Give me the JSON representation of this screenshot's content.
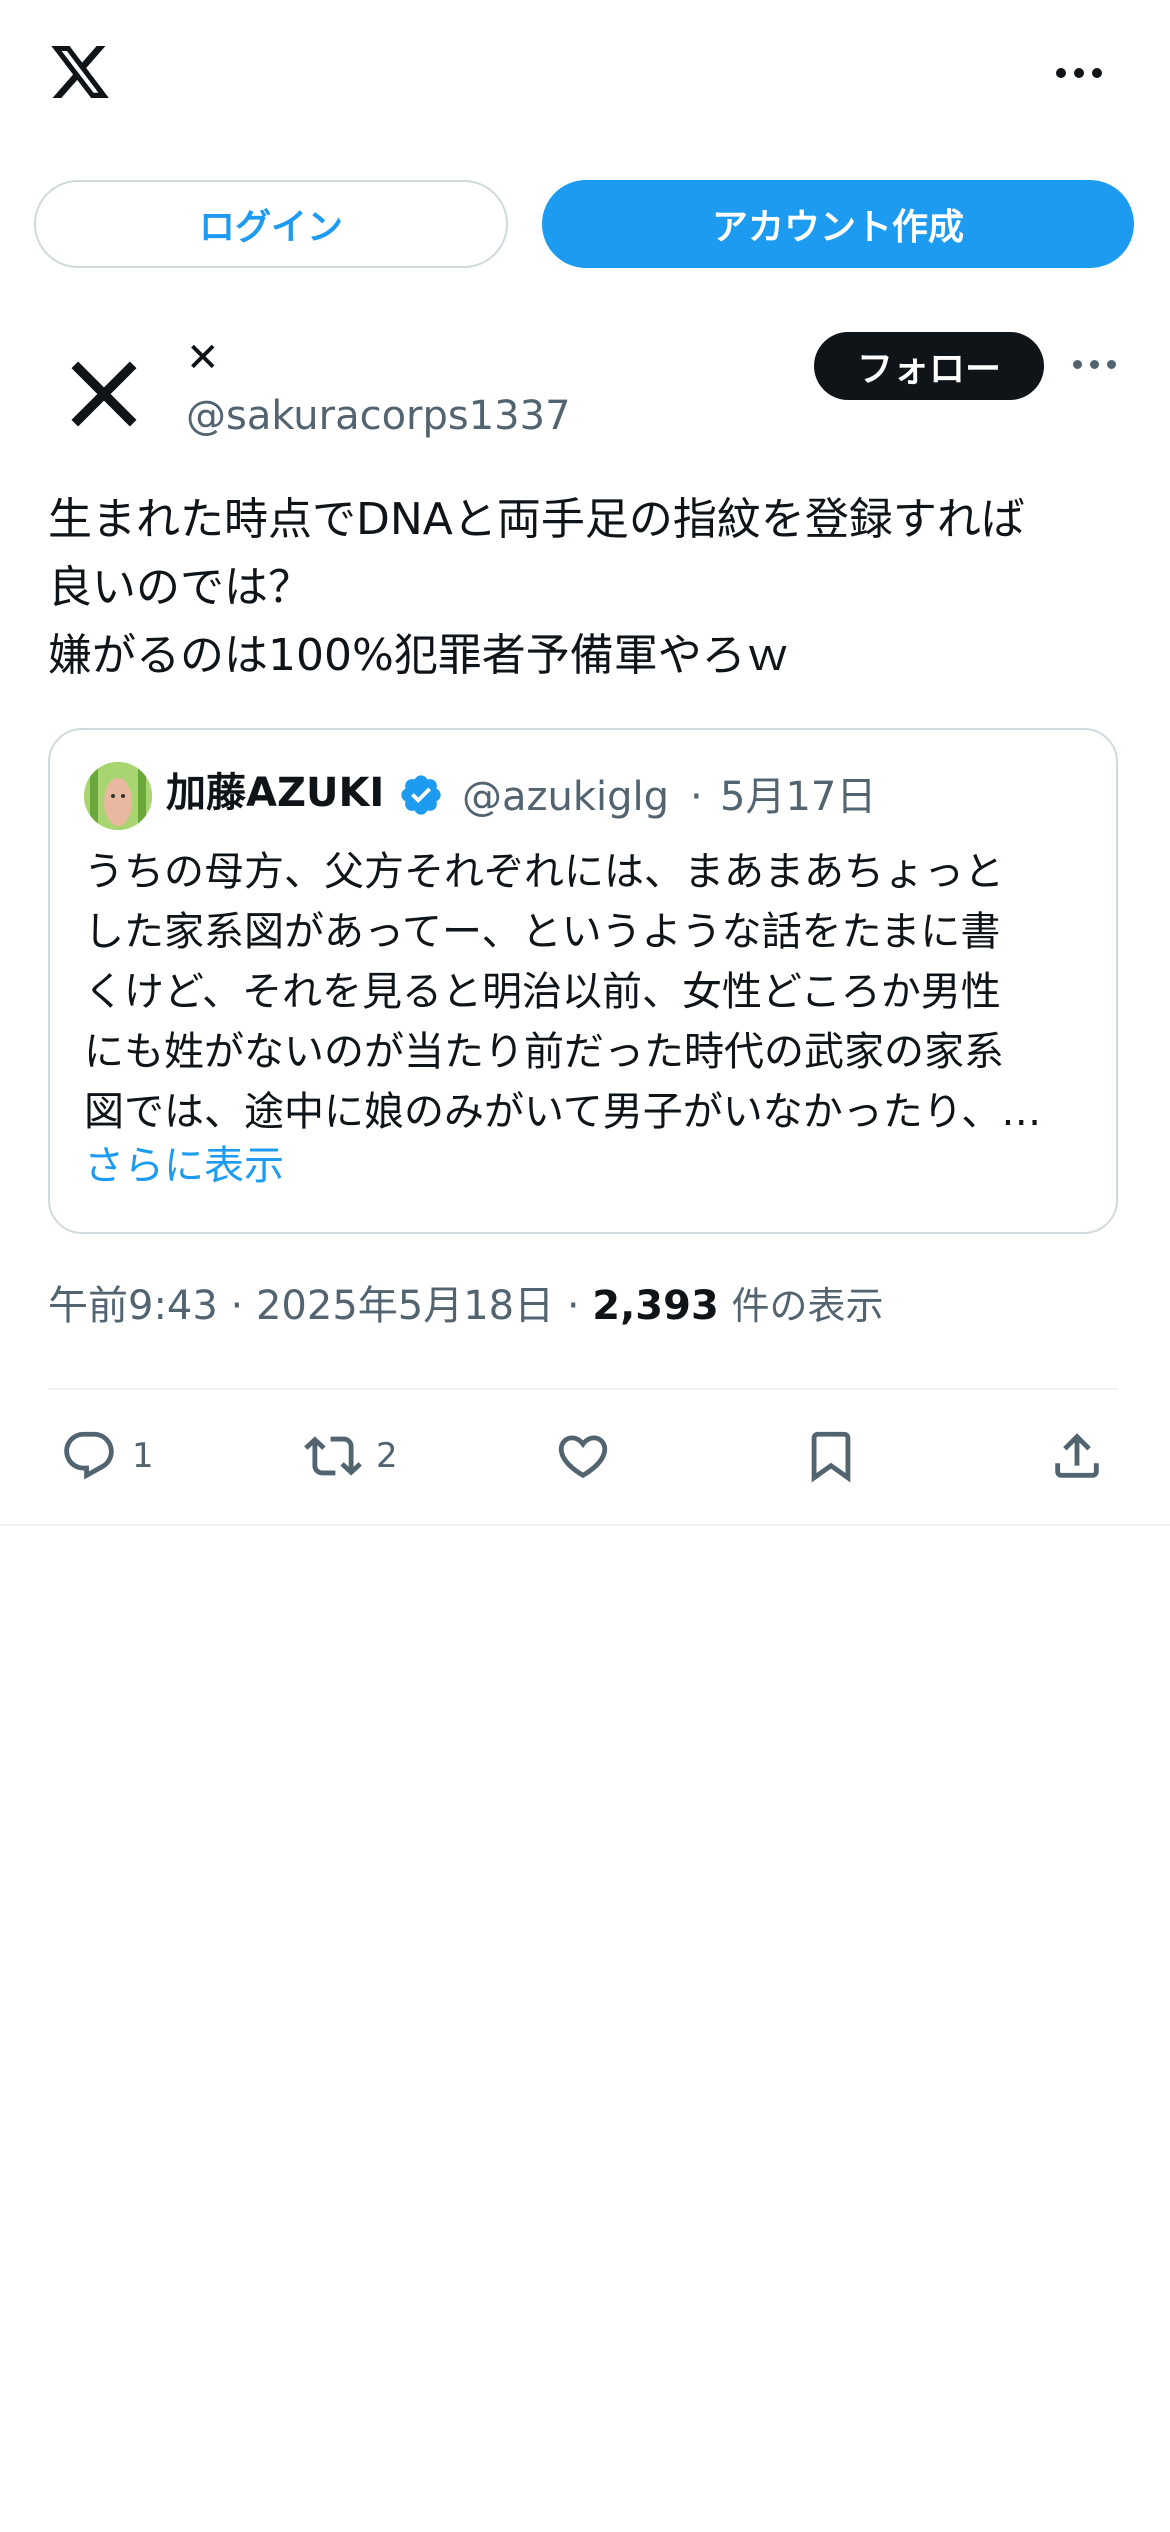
{
  "header": {
    "logo_icon": "x-logo-icon",
    "more_icon": "more-horizontal-icon"
  },
  "auth": {
    "login_label": "ログイン",
    "signup_label": "アカウント作成",
    "accent_color": "#1d9bf0"
  },
  "post": {
    "display_name": "✕",
    "handle": "@sakuracorps1337",
    "follow_label": "フォロー",
    "text": "生まれた時点でDNAと両手足の指紋を登録すれば\n良いのでは？\n嫌がるのは100%犯罪者予備軍やろｗ",
    "timestamp": "午前9:43 · 2025年5月18日",
    "separator": " · ",
    "views_count": "2,393",
    "views_label": "件の表示"
  },
  "quote": {
    "display_name": "加藤AZUKI",
    "verified": true,
    "handle": "@azukiglg",
    "separator": "·",
    "date": "5月17日",
    "text": "うちの母方、父方それぞれには、まあまあちょっと\nした家系図があってー、というような話をたまに書\nくけど、それを見ると明治以前、女性どころか男性\nにも姓がないのが当たり前だった時代の武家の家系\n図では、途中に娘のみがいて男子がいなかったり、…",
    "show_more": "さらに表示"
  },
  "actions": {
    "reply_count": "1",
    "retweet_count": "2",
    "like_count": "",
    "icons": [
      "reply-icon",
      "retweet-icon",
      "like-icon",
      "bookmark-icon",
      "share-icon"
    ]
  }
}
